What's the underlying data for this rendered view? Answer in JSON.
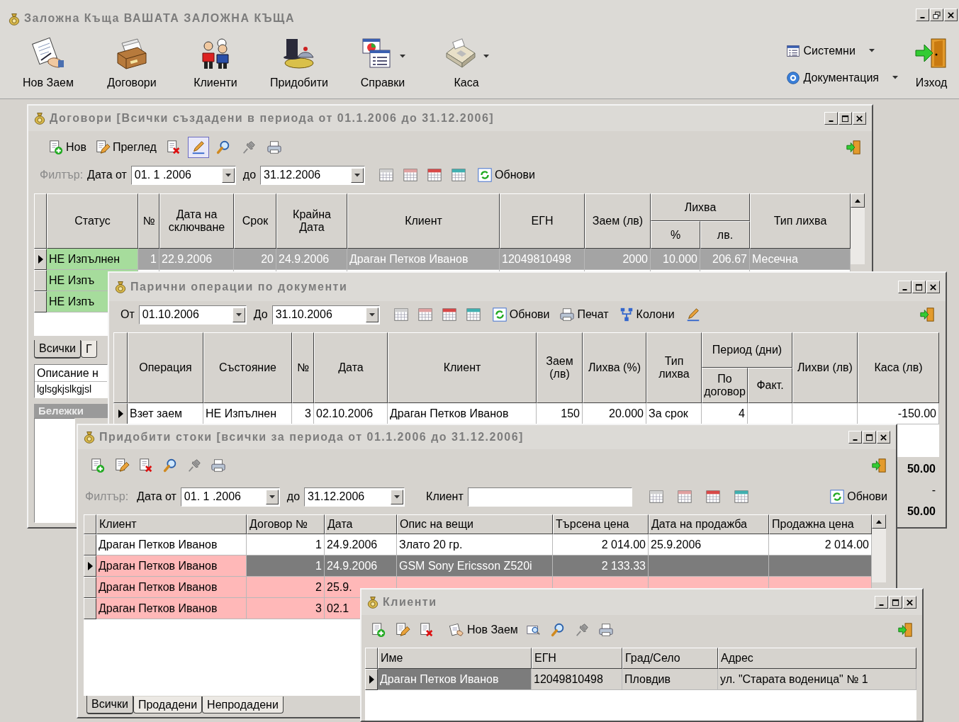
{
  "app": {
    "title": "Заложна Къща ВАШАТА ЗАЛОЖНА КЪЩА",
    "toolbar": [
      {
        "label": "Нов Заем",
        "menu": false
      },
      {
        "label": "Договори",
        "menu": false
      },
      {
        "label": "Клиенти",
        "menu": false
      },
      {
        "label": "Придобити",
        "menu": false
      },
      {
        "label": "Справки",
        "menu": true
      },
      {
        "label": "Каса",
        "menu": true
      }
    ],
    "side_menu": [
      {
        "label": "Системни",
        "menu": true
      },
      {
        "label": "Документация",
        "menu": true
      }
    ],
    "exit_label": "Изход"
  },
  "contracts_window": {
    "title": "Договори [Всички създадени в периода от 01.1.2006 до 31.12.2006]",
    "toolbar": {
      "buttons": [
        {
          "label": "Нов"
        },
        {
          "label": "Преглед"
        }
      ],
      "edit_mode_pressed": true
    },
    "filter": {
      "label": "Филтър:",
      "from_label": "Дата от",
      "from": "01. 1 .2006",
      "to_label": "до",
      "to": "31.12.2006",
      "refresh_label": "Обнови"
    },
    "grid": {
      "columns": [
        {
          "label": "Статус"
        },
        {
          "label": "№"
        },
        {
          "label": "Дата на сключване"
        },
        {
          "label": "Срок"
        },
        {
          "label": "Крайна Дата"
        },
        {
          "label": "Клиент"
        },
        {
          "label": "ЕГН"
        },
        {
          "label": "Заем (лв)"
        },
        {
          "label": "Лихва",
          "children": [
            {
              "label": "%"
            },
            {
              "label": "лв."
            }
          ]
        },
        {
          "label": "Тип лихва"
        }
      ],
      "rows": [
        {
          "selected": true,
          "highlighted": true,
          "color": "#a6dc9c",
          "cells": [
            "НЕ Изпълнен",
            "1",
            "22.9.2006",
            "20",
            "24.9.2006",
            "Драган Петков Иванов",
            "12049810498",
            "2000",
            "10.000",
            "206.67",
            "Месечна"
          ]
        },
        {
          "selected": false,
          "color": "#a6dc9c",
          "cells": [
            "НЕ Изпъ"
          ]
        },
        {
          "selected": false,
          "color": "#a6dc9c",
          "cells": [
            "НЕ Изпъ"
          ]
        }
      ]
    },
    "tabs": [
      {
        "label": "Всички",
        "selected": true
      },
      {
        "label": "Г",
        "selected": false
      }
    ],
    "description_label": "Описание н",
    "description": "lglsgkjslkgjsl",
    "notes_label": "Бележки"
  },
  "cash_window": {
    "title": "Парични операции по документи",
    "filter": {
      "from_label": "От",
      "from": "01.10.2006",
      "to_label": "До",
      "to": "31.10.2006",
      "refresh_label": "Обнови",
      "print_label": "Печат",
      "columns_label": "Колони"
    },
    "grid": {
      "columns": [
        {
          "label": "Операция"
        },
        {
          "label": "Състояние"
        },
        {
          "label": "№"
        },
        {
          "label": "Дата"
        },
        {
          "label": "Клиент"
        },
        {
          "label": "Заем (лв)"
        },
        {
          "label": "Лихва (%)"
        },
        {
          "label": "Тип лихва"
        },
        {
          "label": "Период (дни)",
          "children": [
            {
              "label": "По договор"
            },
            {
              "label": "Факт."
            }
          ]
        },
        {
          "label": "Лихви (лв)"
        },
        {
          "label": "Каса (лв)"
        }
      ],
      "rows": [
        {
          "selected": true,
          "highlighted": false,
          "cells": [
            "Взет заем",
            "НЕ Изпълнен",
            "3",
            "02.10.2006",
            "Драган Петков Иванов",
            "150",
            "20.000",
            "За срок",
            "4",
            "",
            "",
            "-150.00"
          ]
        }
      ]
    },
    "totals": [
      "50.00",
      "-",
      "50.00"
    ]
  },
  "goods_window": {
    "title": "Придобити стоки [всички за периода от 01.1.2006 до 31.12.2006]",
    "filter": {
      "label": "Филтър:",
      "from_label": "Дата от",
      "from": "01. 1 .2006",
      "to_label": "до",
      "to": "31.12.2006",
      "client_label": "Клиент",
      "refresh_label": "Обнови"
    },
    "grid": {
      "columns": [
        {
          "label": "Клиент"
        },
        {
          "label": "Договор №"
        },
        {
          "label": "Дата"
        },
        {
          "label": "Опис на вещи"
        },
        {
          "label": "Търсена цена"
        },
        {
          "label": "Дата на продажба"
        },
        {
          "label": "Продажна цена"
        }
      ],
      "rows": [
        {
          "selected": false,
          "highlighted": false,
          "cells": [
            "Драган Петков Иванов",
            "1",
            "24.9.2006",
            "Злато 20 гр.",
            "2 014.00",
            "25.9.2006",
            "2 014.00"
          ]
        },
        {
          "selected": true,
          "highlighted": true,
          "color": "#ffb8b8",
          "cells": [
            "Драган Петков Иванов",
            "1",
            "24.9.2006",
            "GSM Sony Ericsson Z520i",
            "2 133.33",
            "",
            ""
          ]
        },
        {
          "selected": false,
          "highlighted": false,
          "color": "#ffb8b8",
          "cells": [
            "Драган Петков Иванов",
            "2",
            "25.9."
          ]
        },
        {
          "selected": false,
          "highlighted": false,
          "color": "#ffb8b8",
          "cells": [
            "Драган Петков Иванов",
            "3",
            "02.1"
          ]
        }
      ]
    },
    "tabs": [
      {
        "label": "Всички",
        "selected": true
      },
      {
        "label": "Продадени",
        "selected": false
      },
      {
        "label": "Непродадени",
        "selected": false
      }
    ]
  },
  "clients_window": {
    "title": "Клиенти",
    "new_loan_label": "Нов Заем",
    "grid": {
      "columns": [
        {
          "label": "Име"
        },
        {
          "label": "ЕГН"
        },
        {
          "label": "Град/Село"
        },
        {
          "label": "Адрес"
        }
      ],
      "rows": [
        {
          "selected": true,
          "highlighted": true,
          "cells": [
            "Драган Петков Иванов",
            "12049810498",
            "Пловдив",
            "ул. \"Старата воденица\" № 1"
          ]
        }
      ]
    }
  }
}
